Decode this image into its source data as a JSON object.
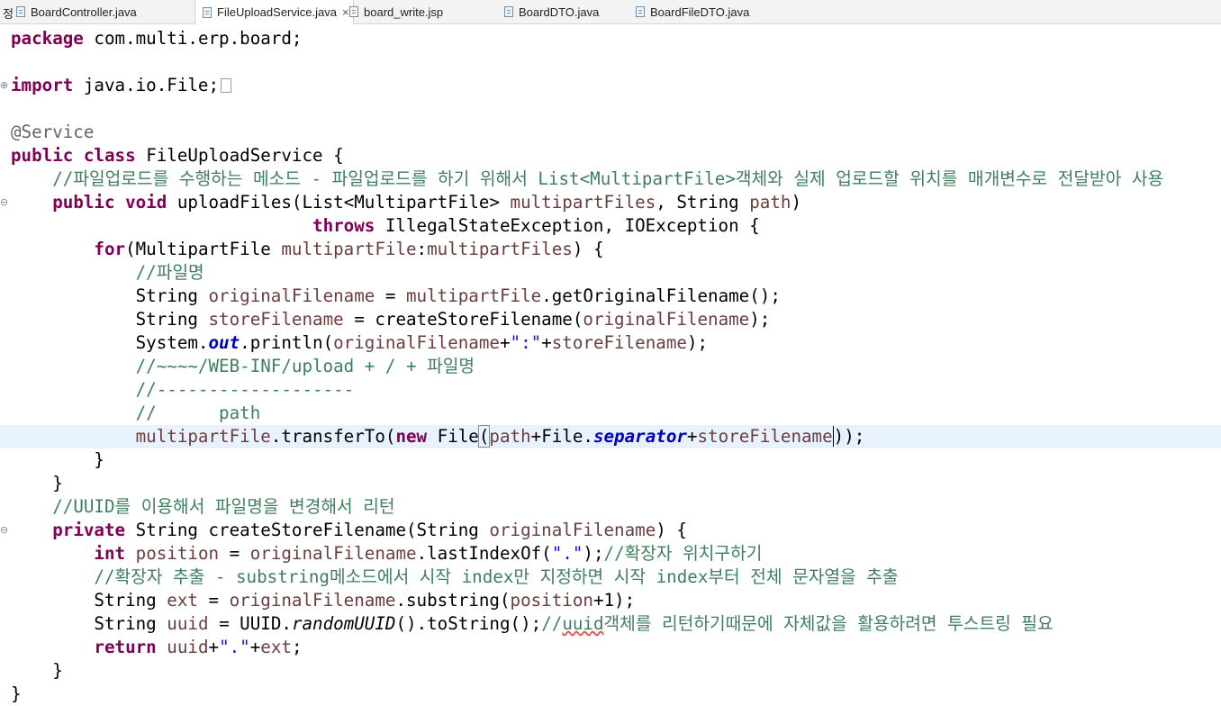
{
  "tabs": {
    "prefix": "정",
    "items": [
      {
        "label": "BoardController.java"
      },
      {
        "label": "FileUploadService.java",
        "close": "×"
      },
      {
        "label": "board_write.jsp"
      },
      {
        "label": "BoardDTO.java"
      },
      {
        "label": "BoardFileDTO.java"
      }
    ]
  },
  "code": {
    "l1": {
      "kw": "package",
      "rest": " com.multi.erp.board;"
    },
    "l3": {
      "kw": "import",
      "rest": " java.io.File;"
    },
    "l5": {
      "ann": "@Service"
    },
    "l6": {
      "kw1": "public",
      "kw2": "class",
      "rest": " FileUploadService {"
    },
    "l7": {
      "cm": "//파일업로드를 수행하는 메소드 - 파일업로드를 하기 위해서 List<MultipartFile>객체와 실제 업로드할 위치를 매개변수로 전달받아 사용"
    },
    "l8": {
      "kw1": "public",
      "kw2": "void",
      "a": " uploadFiles(List<MultipartFile> ",
      "v1": "multipartFiles",
      "b": ", String ",
      "v2": "path",
      "c": ")"
    },
    "l9": {
      "kw": "throws",
      "rest": " IllegalStateException, IOException {"
    },
    "l10": {
      "kw": "for",
      "a": "(MultipartFile ",
      "v1": "multipartFile",
      "b": ":",
      "v2": "multipartFiles",
      "c": ") {"
    },
    "l11": {
      "cm": "//파일명"
    },
    "l12": {
      "a": "String ",
      "v1": "originalFilename",
      "b": " = ",
      "v2": "multipartFile",
      "c": ".getOriginalFilename();"
    },
    "l13": {
      "a": "String ",
      "v1": "storeFilename",
      "b": " = createStoreFilename(",
      "v2": "originalFilename",
      "c": ");"
    },
    "l14": {
      "a": "System.",
      "fld": "out",
      "b": ".println(",
      "v1": "originalFilename",
      "c": "+",
      "str": "\":\"",
      "d": "+",
      "v2": "storeFilename",
      "e": ");"
    },
    "l15": {
      "cm": "//~~~~/WEB-INF/upload + / + 파일명"
    },
    "l16": {
      "cm": "//-------------------"
    },
    "l17": {
      "cm": "//      path"
    },
    "l18": {
      "v1": "multipartFile",
      "a": ".transferTo(",
      "kw": "new",
      "b": " File",
      "br": "(",
      "v2": "path",
      "c": "+File.",
      "fld": "separator",
      "d": "+",
      "v3": "storeFilename",
      "e": "));"
    },
    "l19": {
      "t": "}"
    },
    "l20": {
      "t": "}"
    },
    "l21": {
      "cm": "//UUID를 이용해서 파일명을 변경해서 리턴"
    },
    "l22": {
      "kw": "private",
      "a": " String createStoreFilename(String ",
      "v1": "originalFilename",
      "b": ") {"
    },
    "l23": {
      "kw": "int",
      "a": " ",
      "v1": "position",
      "b": " = ",
      "v2": "originalFilename",
      "c": ".lastIndexOf(",
      "str": "\".\"",
      "d": ");",
      "cm": "//확장자 위치구하기"
    },
    "l24": {
      "cm": "//확장자 추출 - substring메소드에서 시작 index만 지정하면 시작 index부터 전체 문자열을 추출"
    },
    "l25": {
      "a": "String ",
      "v1": "ext",
      "b": " = ",
      "v2": "originalFilename",
      "c": ".substring(",
      "v3": "position",
      "d": "+1);"
    },
    "l26": {
      "a": "String ",
      "v1": "uuid",
      "b": " = UUID.",
      "st": "randomUUID",
      "c": "().toString();",
      "cm1": "//",
      "cm2": "uuid",
      "cm3": "객체를 리턴하기때문에 자체값을 활용하려면 투스트링 필요"
    },
    "l27": {
      "kw": "return",
      "a": " ",
      "v1": "uuid",
      "b": "+",
      "str": "\".\"",
      "c": "+",
      "v2": "ext",
      "d": ";"
    },
    "l28": {
      "t": "}"
    },
    "l29": {
      "t": "}"
    }
  }
}
